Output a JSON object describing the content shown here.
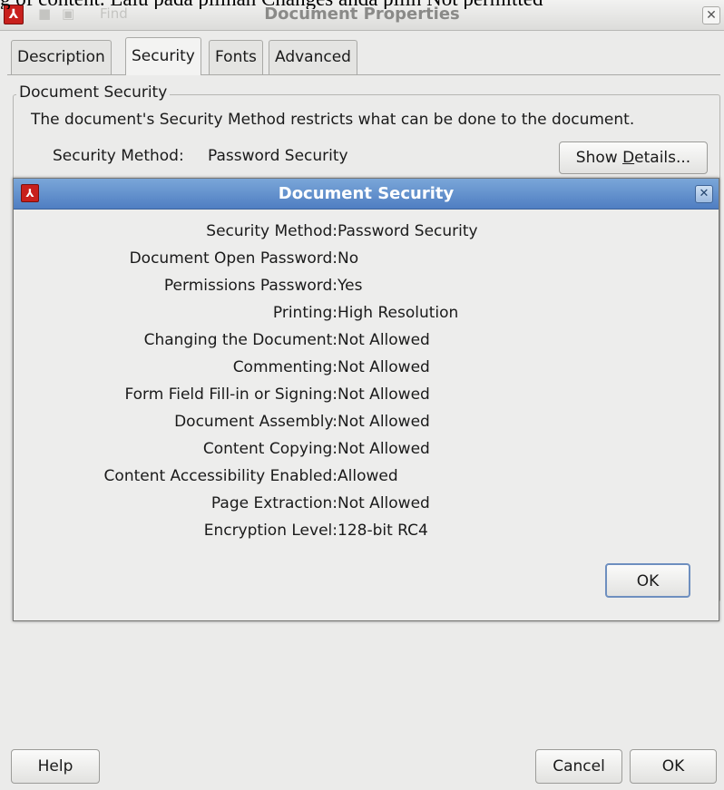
{
  "background_text": "g of content. Lalu pada pilihan Changes anda pilih Not permitted",
  "window": {
    "title": "Document Properties",
    "app_icon": "pdf-app-icon",
    "close_icon": "✕",
    "faded_toolbar_label": "Find"
  },
  "tabs": [
    {
      "label": "Description",
      "active": false
    },
    {
      "label": "Security",
      "active": true
    },
    {
      "label": "Fonts",
      "active": false
    },
    {
      "label": "Advanced",
      "active": false
    }
  ],
  "security_group": {
    "legend": "Document Security",
    "description": "The document's Security Method restricts what can be done to the document.",
    "method_label": "Security Method:",
    "method_value": "Password Security",
    "show_details_label": "Show Details...",
    "show_details_mnemonic": "D"
  },
  "dialog": {
    "title": "Document Security",
    "close_icon": "✕",
    "rows": [
      {
        "label": "Security Method:",
        "value": "Password Security"
      },
      {
        "label": "Document Open Password:",
        "value": "No"
      },
      {
        "label": "Permissions Password:",
        "value": "Yes"
      },
      {
        "label": "Printing:",
        "value": "High Resolution"
      },
      {
        "label": "Changing the Document:",
        "value": "Not Allowed"
      },
      {
        "label": "Commenting:",
        "value": "Not Allowed"
      },
      {
        "label": "Form Field Fill-in or Signing:",
        "value": "Not Allowed"
      },
      {
        "label": "Document Assembly:",
        "value": "Not Allowed"
      },
      {
        "label": "Content Copying:",
        "value": "Not Allowed"
      },
      {
        "label": "Content Accessibility Enabled:",
        "value": "Allowed"
      },
      {
        "label": "Page Extraction:",
        "value": "Not Allowed"
      },
      {
        "label": "Encryption Level:",
        "value": "128-bit RC4"
      }
    ],
    "ok_label": "OK"
  },
  "footer": {
    "help_label": "Help",
    "cancel_label": "Cancel",
    "ok_label": "OK"
  },
  "colors": {
    "dialog_titlebar": "#5b87c8",
    "window_background": "#ebebea",
    "pdf_icon_red": "#c8201c"
  }
}
